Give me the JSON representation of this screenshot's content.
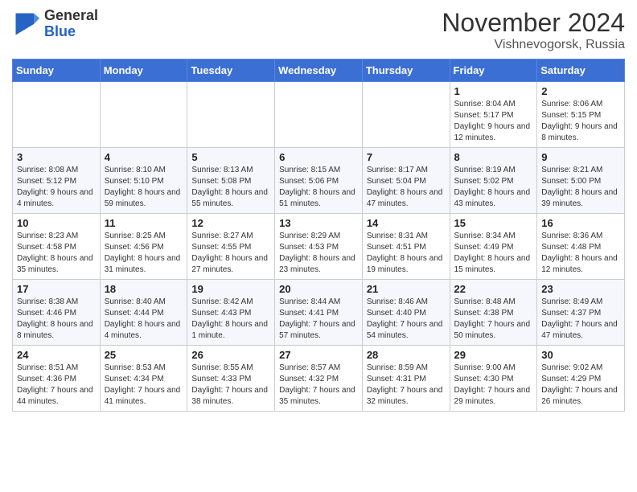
{
  "logo": {
    "general": "General",
    "blue": "Blue"
  },
  "header": {
    "month": "November 2024",
    "location": "Vishnevogorsk, Russia"
  },
  "weekdays": [
    "Sunday",
    "Monday",
    "Tuesday",
    "Wednesday",
    "Thursday",
    "Friday",
    "Saturday"
  ],
  "weeks": [
    [
      {
        "day": "",
        "info": ""
      },
      {
        "day": "",
        "info": ""
      },
      {
        "day": "",
        "info": ""
      },
      {
        "day": "",
        "info": ""
      },
      {
        "day": "",
        "info": ""
      },
      {
        "day": "1",
        "info": "Sunrise: 8:04 AM\nSunset: 5:17 PM\nDaylight: 9 hours and 12 minutes."
      },
      {
        "day": "2",
        "info": "Sunrise: 8:06 AM\nSunset: 5:15 PM\nDaylight: 9 hours and 8 minutes."
      }
    ],
    [
      {
        "day": "3",
        "info": "Sunrise: 8:08 AM\nSunset: 5:12 PM\nDaylight: 9 hours and 4 minutes."
      },
      {
        "day": "4",
        "info": "Sunrise: 8:10 AM\nSunset: 5:10 PM\nDaylight: 8 hours and 59 minutes."
      },
      {
        "day": "5",
        "info": "Sunrise: 8:13 AM\nSunset: 5:08 PM\nDaylight: 8 hours and 55 minutes."
      },
      {
        "day": "6",
        "info": "Sunrise: 8:15 AM\nSunset: 5:06 PM\nDaylight: 8 hours and 51 minutes."
      },
      {
        "day": "7",
        "info": "Sunrise: 8:17 AM\nSunset: 5:04 PM\nDaylight: 8 hours and 47 minutes."
      },
      {
        "day": "8",
        "info": "Sunrise: 8:19 AM\nSunset: 5:02 PM\nDaylight: 8 hours and 43 minutes."
      },
      {
        "day": "9",
        "info": "Sunrise: 8:21 AM\nSunset: 5:00 PM\nDaylight: 8 hours and 39 minutes."
      }
    ],
    [
      {
        "day": "10",
        "info": "Sunrise: 8:23 AM\nSunset: 4:58 PM\nDaylight: 8 hours and 35 minutes."
      },
      {
        "day": "11",
        "info": "Sunrise: 8:25 AM\nSunset: 4:56 PM\nDaylight: 8 hours and 31 minutes."
      },
      {
        "day": "12",
        "info": "Sunrise: 8:27 AM\nSunset: 4:55 PM\nDaylight: 8 hours and 27 minutes."
      },
      {
        "day": "13",
        "info": "Sunrise: 8:29 AM\nSunset: 4:53 PM\nDaylight: 8 hours and 23 minutes."
      },
      {
        "day": "14",
        "info": "Sunrise: 8:31 AM\nSunset: 4:51 PM\nDaylight: 8 hours and 19 minutes."
      },
      {
        "day": "15",
        "info": "Sunrise: 8:34 AM\nSunset: 4:49 PM\nDaylight: 8 hours and 15 minutes."
      },
      {
        "day": "16",
        "info": "Sunrise: 8:36 AM\nSunset: 4:48 PM\nDaylight: 8 hours and 12 minutes."
      }
    ],
    [
      {
        "day": "17",
        "info": "Sunrise: 8:38 AM\nSunset: 4:46 PM\nDaylight: 8 hours and 8 minutes."
      },
      {
        "day": "18",
        "info": "Sunrise: 8:40 AM\nSunset: 4:44 PM\nDaylight: 8 hours and 4 minutes."
      },
      {
        "day": "19",
        "info": "Sunrise: 8:42 AM\nSunset: 4:43 PM\nDaylight: 8 hours and 1 minute."
      },
      {
        "day": "20",
        "info": "Sunrise: 8:44 AM\nSunset: 4:41 PM\nDaylight: 7 hours and 57 minutes."
      },
      {
        "day": "21",
        "info": "Sunrise: 8:46 AM\nSunset: 4:40 PM\nDaylight: 7 hours and 54 minutes."
      },
      {
        "day": "22",
        "info": "Sunrise: 8:48 AM\nSunset: 4:38 PM\nDaylight: 7 hours and 50 minutes."
      },
      {
        "day": "23",
        "info": "Sunrise: 8:49 AM\nSunset: 4:37 PM\nDaylight: 7 hours and 47 minutes."
      }
    ],
    [
      {
        "day": "24",
        "info": "Sunrise: 8:51 AM\nSunset: 4:36 PM\nDaylight: 7 hours and 44 minutes."
      },
      {
        "day": "25",
        "info": "Sunrise: 8:53 AM\nSunset: 4:34 PM\nDaylight: 7 hours and 41 minutes."
      },
      {
        "day": "26",
        "info": "Sunrise: 8:55 AM\nSunset: 4:33 PM\nDaylight: 7 hours and 38 minutes."
      },
      {
        "day": "27",
        "info": "Sunrise: 8:57 AM\nSunset: 4:32 PM\nDaylight: 7 hours and 35 minutes."
      },
      {
        "day": "28",
        "info": "Sunrise: 8:59 AM\nSunset: 4:31 PM\nDaylight: 7 hours and 32 minutes."
      },
      {
        "day": "29",
        "info": "Sunrise: 9:00 AM\nSunset: 4:30 PM\nDaylight: 7 hours and 29 minutes."
      },
      {
        "day": "30",
        "info": "Sunrise: 9:02 AM\nSunset: 4:29 PM\nDaylight: 7 hours and 26 minutes."
      }
    ]
  ]
}
